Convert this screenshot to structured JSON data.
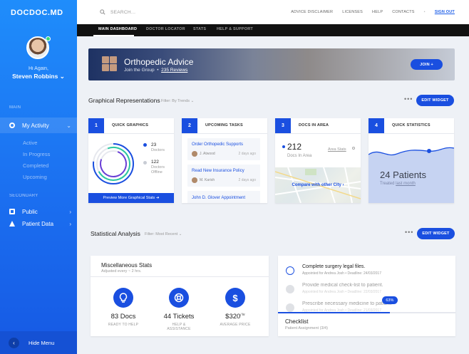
{
  "sidebar": {
    "logo": "DOCDOC.MD",
    "greeting": "Hi Again,",
    "user_name": "Steven Robbins",
    "section_main": "MAIN",
    "my_activity": "My Activity",
    "sub_items": [
      "Active",
      "In Progress",
      "Completed",
      "Upcoming"
    ],
    "section_secondary": "SECONDARY",
    "public": "Public",
    "patient_data": "Patient Data",
    "hide_menu": "Hide Menu"
  },
  "topbar": {
    "search_placeholder": "SEARCH...",
    "links": [
      "ADVICE DISCLAIMER",
      "LICENSES",
      "HELP",
      "CONTACTS"
    ],
    "sign_out": "SIGN OUT"
  },
  "tabs": [
    "MAIN DASHBOARD",
    "DOCTOR LOCATOR",
    "STATS",
    "HELP & SUPPORT"
  ],
  "banner": {
    "title": "Orthopedic Advice",
    "subtitle": "Join the Group",
    "reviews": "235 Reviews",
    "join": "JOIN +"
  },
  "graphical": {
    "title": "Graphical Representations",
    "filter": "Filter: By Trends",
    "edit": "EDIT WIDGET"
  },
  "quick_graphics": {
    "num": "1",
    "title": "QUICK GRAPHICS",
    "docs_count": "23",
    "docs_label": "Doctors",
    "offline_count": "122",
    "offline_label1": "Doctors",
    "offline_label2": "Offline",
    "footer": "Preview More Graphical Stats"
  },
  "upcoming_tasks": {
    "num": "2",
    "title": "UPCOMING TASKS",
    "items": [
      {
        "title": "Order Orthopedic Supports",
        "person": "J. Atwood",
        "time": "2 days ago"
      },
      {
        "title": "Read New Insurance Policy",
        "person": "M. Karish",
        "time": "2 days ago"
      }
    ],
    "third": "John D. Glover Appointment"
  },
  "docs_area": {
    "num": "3",
    "title": "DOCS IN AREA",
    "count": "212",
    "label": "Docs In Area",
    "link": "Area Stats",
    "compare": "Compare with other City"
  },
  "quick_stats": {
    "num": "4",
    "title": "QUICK STATISTICS",
    "patients": "24 Patients",
    "treated_prefix": "Treated",
    "treated_link": "last month"
  },
  "statistical": {
    "title": "Statistical Analysis",
    "filter": "Filter: Most Recent",
    "edit": "EDIT WIDGET"
  },
  "misc": {
    "title": "Miscellaneous Stats",
    "subtitle": "Adjusted every ~ 2 hrs.",
    "stats": [
      {
        "icon": "lightbulb-icon",
        "value": "83 Docs",
        "label": "READY TO HELP"
      },
      {
        "icon": "lifebuoy-icon",
        "value": "44 Tickets",
        "label": "HELP & ASSISTANCE"
      },
      {
        "icon": "dollar-icon",
        "value": "$320",
        "unit": "/ hr",
        "label": "AVERAGE PRICE"
      }
    ]
  },
  "checklist": {
    "items": [
      {
        "text": "Complete surgery legal files.",
        "meta": "Appointed for Andrea Josh  •  Deadline: 24/03/2017",
        "done": false
      },
      {
        "text": "Provide medical check-list to patient.",
        "meta": "Appointed for Andrea Josh  •  Deadline: 22/03/2017",
        "done": true
      },
      {
        "text": "Prescribe necessary medicine to patient.",
        "meta": "Appointed for Andrea Josh  •  Deadline: 21/03/2017",
        "done": true
      }
    ],
    "progress_label": "63%",
    "progress": 0.63,
    "title": "Checklist",
    "subtitle": "Patient Assignment (3/4)"
  },
  "colors": {
    "accent": "#1a4fe0",
    "sidebar_top": "#1f8dfb",
    "sidebar_bottom": "#1659e4",
    "green": "#35d67a"
  }
}
